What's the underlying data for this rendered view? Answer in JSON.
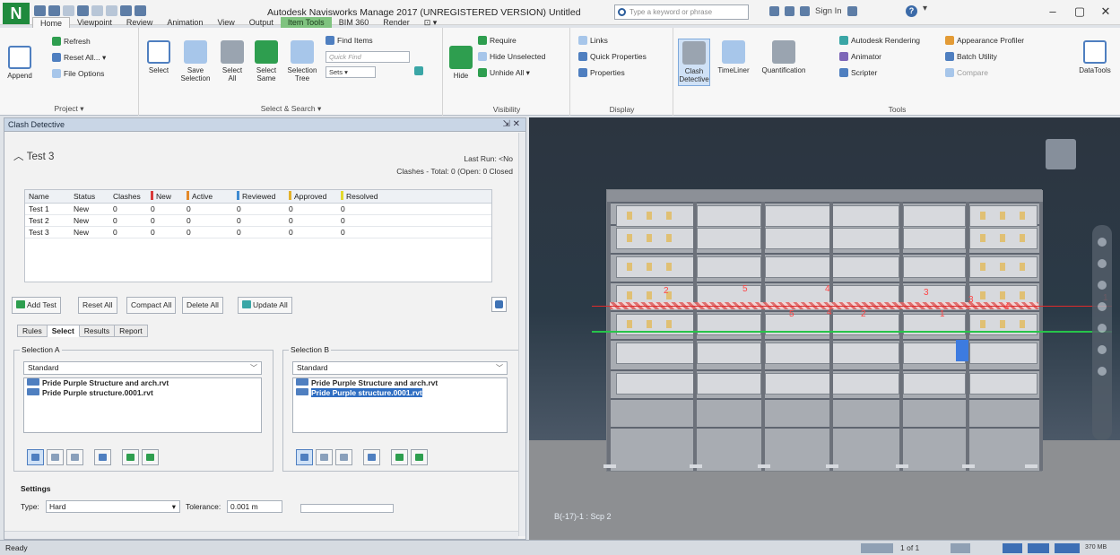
{
  "app": {
    "logo": "N",
    "title": "Autodesk Navisworks Manage 2017 (UNREGISTERED VERSION)   Untitled",
    "search_placeholder": "Type a keyword or phrase",
    "sign_in": "Sign In",
    "help": "?",
    "window_buttons": [
      "–",
      "▢",
      "✕"
    ]
  },
  "ribbon_tabs": [
    "Home",
    "Viewpoint",
    "Review",
    "Animation",
    "View",
    "Output",
    "Item Tools",
    "BIM 360",
    "Render",
    "⊡ ▾"
  ],
  "ribbon": {
    "project": {
      "label": "Project ▾",
      "append": "Append",
      "refresh": "Refresh",
      "reset_all": "Reset All... ▾",
      "file_options": "File Options"
    },
    "select_search": {
      "label": "Select & Search ▾",
      "select": "Select",
      "save_selection": "Save Selection",
      "select_all": "Select All",
      "select_same": "Select Same",
      "selection_tree": "Selection Tree",
      "find_items": "Find Items",
      "quick_find_placeholder": "Quick Find",
      "sets": "Sets ▾"
    },
    "visibility": {
      "label": "Visibility",
      "hide": "Hide",
      "require": "Require",
      "hide_unselected": "Hide Unselected",
      "unhide_all": "Unhide All ▾"
    },
    "display": {
      "label": "Display",
      "links": "Links",
      "quick_properties": "Quick Properties",
      "properties": "Properties"
    },
    "tools": {
      "label": "Tools",
      "clash_detective": "Clash Detective",
      "timeliner": "TimeLiner",
      "quantification": "Quantification",
      "autodesk_rendering": "Autodesk Rendering",
      "animator": "Animator",
      "scripter": "Scripter",
      "appearance_profiler": "Appearance Profiler",
      "batch_utility": "Batch Utility",
      "compare": "Compare",
      "datatools": "DataTools"
    }
  },
  "clash": {
    "pane_title": "Clash Detective",
    "pane_controls": "⇲ ✕",
    "test_name": "Test 3",
    "last_run": "Last Run: <No",
    "clashes_summary": "Clashes - Total: 0 (Open: 0 Closed",
    "table": {
      "headers": [
        "Name",
        "Status",
        "Clashes",
        "New",
        "Active",
        "Reviewed",
        "Approved",
        "Resolved"
      ],
      "flag_colors": [
        "",
        "",
        "",
        "#d93a3a",
        "#e38a2b",
        "#3d8ad1",
        "#e3b22b",
        "#e3d92b"
      ],
      "rows": [
        [
          "Test 1",
          "New",
          "0",
          "0",
          "0",
          "0",
          "0",
          "0"
        ],
        [
          "Test 2",
          "New",
          "0",
          "0",
          "0",
          "0",
          "0",
          "0"
        ],
        [
          "Test 3",
          "New",
          "0",
          "0",
          "0",
          "0",
          "0",
          "0"
        ]
      ]
    },
    "buttons": {
      "add_test": "Add Test",
      "reset_all": "Reset All",
      "compact_all": "Compact All",
      "delete_all": "Delete All",
      "update_all": "Update All"
    },
    "subtabs": [
      "Rules",
      "Select",
      "Results",
      "Report"
    ],
    "selection_a": {
      "legend": "Selection A",
      "mode": "Standard",
      "items": [
        "Pride Purple Structure and arch.rvt",
        "Pride Purple structure.0001.rvt"
      ]
    },
    "selection_b": {
      "legend": "Selection B",
      "mode": "Standard",
      "items": [
        "Pride Purple Structure and arch.rvt",
        "Pride Purple structure.0001.rvt"
      ]
    },
    "settings": {
      "title": "Settings",
      "type_label": "Type:",
      "type_value": "Hard",
      "tolerance_label": "Tolerance:",
      "tolerance_value": "0.001 m"
    }
  },
  "viewport": {
    "label": "B(-17)-1 : Scp 2",
    "clash_numbers": [
      "1",
      "2",
      "3",
      "4",
      "5",
      "4",
      "5",
      "2",
      "1",
      "4",
      "3"
    ]
  },
  "status": {
    "ready": "Ready",
    "sheet": "1 of 1",
    "memory": "370 MB"
  }
}
